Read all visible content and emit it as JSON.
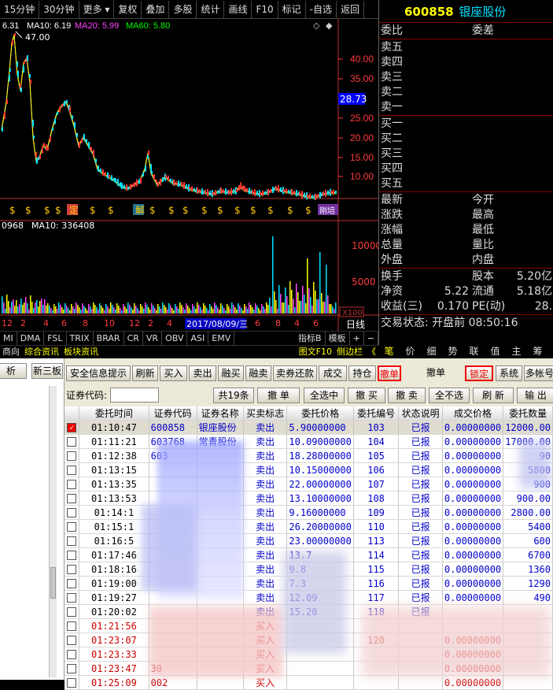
{
  "topbar": {
    "tabs": [
      "15分钟",
      "30分钟",
      "更多",
      "复权",
      "叠加",
      "多股",
      "统计",
      "画线",
      "F10",
      "标记",
      "-自选",
      "返回"
    ]
  },
  "chart": {
    "ma_line": {
      "price": "6.31",
      "ma10": "MA10: 6.19",
      "ma20": "MA20: 5.99",
      "ma60": "MA60: 5.80"
    },
    "peak_label": "47.00",
    "price_axis": [
      "40.00",
      "35.00",
      "25.00",
      "20.00",
      "15.00",
      "10.00"
    ],
    "current_price": "28.73",
    "vol_line": {
      "left": "0968",
      "ma10": "MA10: 336408"
    },
    "vol_axis": [
      "10000",
      "5000"
    ],
    "vol_unit": "X100",
    "date_ticks": [
      "12",
      "2",
      "4",
      "6",
      "8",
      "10",
      "12",
      "2",
      "4",
      "6",
      "8",
      "4",
      "6",
      "8",
      "10"
    ],
    "date_cursor": "2017/08/09/三",
    "day_label": "日线",
    "markers": [
      "$",
      "$",
      "$",
      "$",
      "定",
      "$",
      "$",
      "解",
      "$",
      "$",
      "$",
      "$",
      "$",
      "$",
      "$",
      "$",
      "$",
      "$"
    ],
    "marker_end": "刚培"
  },
  "indicator_tabs": [
    "MI",
    "DMA",
    "FSL",
    "TRIX",
    "BRAR",
    "CR",
    "VR",
    "OBV",
    "ASI",
    "EMV",
    "指标B",
    "模板",
    "+",
    "−"
  ],
  "bottom_tabs": [
    "商向",
    "综合资讯",
    "板块资讯",
    "图文F10",
    "侧边栏",
    "《"
  ],
  "right_tabs": [
    "笔",
    "价",
    "细",
    "势",
    "联",
    "值",
    "主",
    "筹"
  ],
  "quote": {
    "code": "600858",
    "name": "银座股份",
    "header": [
      "委比",
      "委差"
    ],
    "sell": [
      "卖五",
      "卖四",
      "卖三",
      "卖二",
      "卖一"
    ],
    "buy": [
      "买一",
      "买二",
      "买三",
      "买四",
      "买五"
    ],
    "stats_left": [
      "最新",
      "涨跌",
      "涨幅",
      "总量",
      "外盘"
    ],
    "stats_right": [
      "今开",
      "最高",
      "最低",
      "量比",
      "内盘"
    ],
    "extra": [
      {
        "l": "换手",
        "lv": "",
        "r": "股本",
        "rv": "5.20亿"
      },
      {
        "l": "净资",
        "lv": "5.22",
        "r": "流通",
        "rv": "5.18亿"
      },
      {
        "l": "收益(三)",
        "lv": "0.170",
        "r": "PE(动)",
        "rv": "28."
      }
    ],
    "status": "交易状态: 开盘前 08:50:16"
  },
  "lower": {
    "left_tabs": [
      "析",
      "新三板"
    ],
    "toolbar": [
      "安全信息提示",
      "刷新",
      "买入",
      "卖出",
      "融买",
      "融卖",
      "卖券还款",
      "成交",
      "持仓",
      "撤单",
      "撤单",
      "锁定",
      "系统",
      "多帐号"
    ],
    "code_label": "证券代码:",
    "actions": [
      "共19条",
      "撤 单",
      "全选中",
      "撤 买",
      "撤 卖",
      "全不选",
      "刷 新",
      "输 出"
    ],
    "columns": [
      "委托时间",
      "证券代码",
      "证券名称",
      "买卖标志",
      "委托价格",
      "委托编号",
      "状态说明",
      "成交价格",
      "委托数量"
    ],
    "rows": [
      {
        "t": "01:10:47",
        "c": "600858",
        "n": "银座股份",
        "s": "卖出",
        "p": "5.90000000",
        "id": "103",
        "st": "已报",
        "cp": "0.00000000",
        "q": "12000.00",
        "side": "sell",
        "checked": true
      },
      {
        "t": "01:11:21",
        "c": "603768",
        "n": "常青股份",
        "s": "卖出",
        "p": "10.09000000",
        "id": "104",
        "st": "已报",
        "cp": "0.00000000",
        "q": "17000.00",
        "side": "sell"
      },
      {
        "t": "01:12:38",
        "c": "603",
        "n": "",
        "s": "卖出",
        "p": "18.28000000",
        "id": "105",
        "st": "已报",
        "cp": "0.00000000",
        "q": "90",
        "side": "sell"
      },
      {
        "t": "01:13:15",
        "c": "",
        "n": "",
        "s": "卖出",
        "p": "10.15000000",
        "id": "106",
        "st": "已报",
        "cp": "0.00000000",
        "q": "5800",
        "side": "sell"
      },
      {
        "t": "01:13:35",
        "c": "",
        "n": "",
        "s": "卖出",
        "p": "22.00000000",
        "id": "107",
        "st": "已报",
        "cp": "0.00000000",
        "q": "900",
        "side": "sell"
      },
      {
        "t": "01:13:53",
        "c": "",
        "n": "",
        "s": "卖出",
        "p": "13.10000000",
        "id": "108",
        "st": "已报",
        "cp": "0.00000000",
        "q": "900.00",
        "side": "sell"
      },
      {
        "t": "01:14:1",
        "c": "",
        "n": "",
        "s": "卖出",
        "p": "9.16000000",
        "id": "109",
        "st": "已报",
        "cp": "0.00000000",
        "q": "2800.00",
        "side": "sell"
      },
      {
        "t": "01:15:1",
        "c": "",
        "n": "",
        "s": "卖出",
        "p": "26.20000000",
        "id": "110",
        "st": "已报",
        "cp": "0.00000000",
        "q": "5400",
        "side": "sell"
      },
      {
        "t": "01:16:5",
        "c": "",
        "n": "",
        "s": "卖出",
        "p": "23.00000000",
        "id": "113",
        "st": "已报",
        "cp": "0.00000000",
        "q": "600",
        "side": "sell"
      },
      {
        "t": "01:17:46",
        "c": "",
        "n": "",
        "s": "卖出",
        "p": "13.7",
        "id": "114",
        "st": "已报",
        "cp": "0.00000000",
        "q": "6700",
        "side": "sell"
      },
      {
        "t": "01:18:16",
        "c": "",
        "n": "",
        "s": "卖出",
        "p": "9.8",
        "id": "115",
        "st": "已报",
        "cp": "0.00000000",
        "q": "1360",
        "side": "sell"
      },
      {
        "t": "01:19:00",
        "c": "",
        "n": "",
        "s": "卖出",
        "p": "7.3",
        "id": "116",
        "st": "已报",
        "cp": "0.00000000",
        "q": "1290",
        "side": "sell"
      },
      {
        "t": "01:19:27",
        "c": "",
        "n": "",
        "s": "卖出",
        "p": "12.09",
        "id": "117",
        "st": "已报",
        "cp": "0.00000000",
        "q": "490",
        "side": "sell"
      },
      {
        "t": "01:20:02",
        "c": "",
        "n": "",
        "s": "卖出",
        "p": "15.20",
        "id": "118",
        "st": "已报",
        "cp": "",
        "q": "",
        "side": "sell"
      },
      {
        "t": "01:21:56",
        "c": "",
        "n": "",
        "s": "买入",
        "p": "",
        "id": "",
        "st": "",
        "cp": "",
        "q": "",
        "side": "buy"
      },
      {
        "t": "01:23:07",
        "c": "",
        "n": "",
        "s": "买入",
        "p": "",
        "id": "120",
        "st": "",
        "cp": "0.00000000",
        "q": "",
        "side": "buy"
      },
      {
        "t": "01:23:33",
        "c": "",
        "n": "",
        "s": "买入",
        "p": "",
        "id": "",
        "st": "",
        "cp": "0.00000000",
        "q": "",
        "side": "buy"
      },
      {
        "t": "01:23:47",
        "c": "30",
        "n": "",
        "s": "买入",
        "p": "",
        "id": "",
        "st": "",
        "cp": "0.00000000",
        "q": "",
        "side": "buy"
      },
      {
        "t": "01:25:09",
        "c": "002",
        "n": "",
        "s": "买入",
        "p": "",
        "id": "",
        "st": "",
        "cp": "0.00000000",
        "q": "",
        "side": "buy"
      }
    ]
  },
  "colors": {
    "bg": "#000000",
    "up": "#ff3232",
    "down": "#00e0ff",
    "ma10": "#ffffff",
    "ma20": "#ff44ff",
    "ma60": "#00ff00",
    "axis_red": "#ff3c3c",
    "gold": "#ffcc00",
    "selected": "#ff0000"
  }
}
